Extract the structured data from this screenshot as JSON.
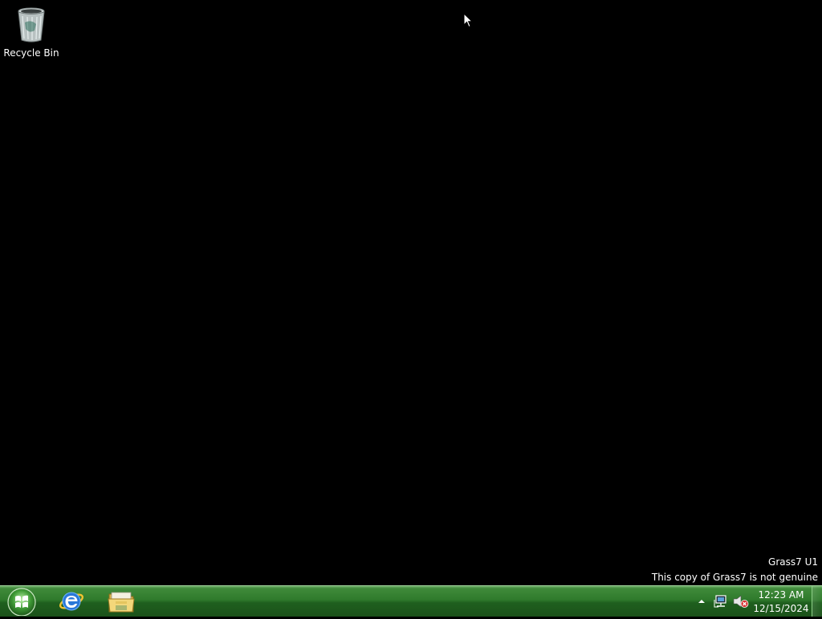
{
  "desktop": {
    "icons": [
      {
        "label": "Recycle Bin",
        "icon": "recycle-bin-icon"
      }
    ],
    "watermark": {
      "line1": "Grass7 U1",
      "line2": "This copy of Grass7 is not genuine"
    }
  },
  "taskbar": {
    "start_icon": "start-orb-icon",
    "pinned": [
      {
        "icon": "internet-explorer-icon"
      },
      {
        "icon": "file-explorer-icon"
      }
    ],
    "tray": {
      "icons": [
        "show-hidden-icons-arrow",
        "network-icon",
        "volume-muted-icon"
      ],
      "time": "12:23 AM",
      "date": "12/15/2024"
    }
  },
  "colors": {
    "desktop_bg": "#000000",
    "taskbar_green": "#2f7a2c"
  }
}
